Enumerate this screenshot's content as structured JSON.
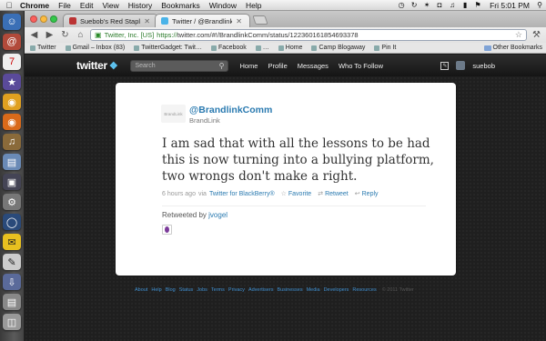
{
  "menubar": {
    "app_name": "Chrome",
    "menus": [
      "File",
      "Edit",
      "View",
      "History",
      "Bookmarks",
      "Window",
      "Help"
    ],
    "clock": "Fri 5:01 PM"
  },
  "tabs": [
    {
      "title": "Suebob's Red Stapler",
      "active": false
    },
    {
      "title": "Twitter / @BrandlinkComm",
      "active": true
    }
  ],
  "omnibox": {
    "ev_label": "Twitter, Inc. [US]",
    "scheme": "https://",
    "rest": "twitter.com/#!/BrandlinkComm/status/122360161854693378"
  },
  "bookmarks": {
    "items": [
      "Twitter",
      "Gmail – Inbox (83)",
      "TwitterGadget: Twit…",
      "Facebook",
      "…",
      "Home",
      "Camp Blogaway",
      "Pin It"
    ],
    "other": "Other Bookmarks"
  },
  "twitter": {
    "logo": "twitter",
    "search_placeholder": "Search",
    "nav": [
      "Home",
      "Profile",
      "Messages",
      "Who To Follow"
    ],
    "user": "suebob"
  },
  "tweet": {
    "avatar_text": "BrandLink",
    "handle": "@BrandlinkComm",
    "name": "BrandLink",
    "text": "I am sad that with all the lessons to be had this is now turning into a bullying platform, two wrongs don't make a right.",
    "time": "6 hours ago",
    "via": "via",
    "client": "Twitter for BlackBerry®",
    "favorite_label": "Favorite",
    "retweet_label": "Retweet",
    "reply_label": "Reply",
    "retweeted_by_label": "Retweeted by",
    "retweeted_by_user": "jvogel"
  },
  "footer": {
    "links": [
      "About",
      "Help",
      "Blog",
      "Status",
      "Jobs",
      "Terms",
      "Privacy",
      "Advertisers",
      "Businesses",
      "Media",
      "Developers",
      "Resources"
    ],
    "copyright": "© 2011 Twitter"
  },
  "colors": {
    "link_blue": "#2a7ab0",
    "twitter_bar": "#1b1b1b",
    "retweet_avatar": "#7b3a9a"
  }
}
